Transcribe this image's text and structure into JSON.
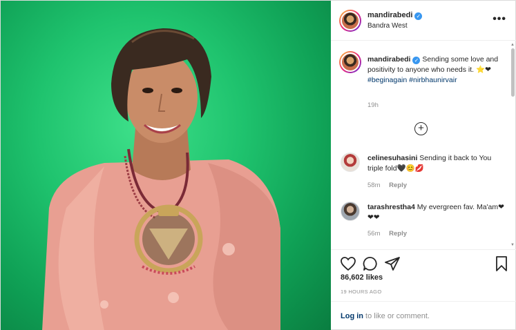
{
  "post": {
    "username": "mandirabedi",
    "location": "Bandra West",
    "more_label": "•••",
    "verified_glyph": "✓"
  },
  "caption": {
    "username": "mandirabedi",
    "text": "Sending some love and positivity to anyone who needs it. ⭐❤",
    "hashtags": "#beginagain #nirbhaunirvair",
    "time": "19h",
    "load_more_glyph": "+"
  },
  "comments": [
    {
      "username": "celinesuhasini",
      "text": "Sending it back to You triple fold🖤😊💋",
      "time": "58m",
      "reply": "Reply"
    },
    {
      "username": "tarashrestha4",
      "text": "My evergreen fav. Ma'am❤❤❤",
      "time": "56m",
      "reply": "Reply"
    }
  ],
  "actions": {
    "likes": "86,602 likes",
    "time_ago": "19 HOURS AGO"
  },
  "login": {
    "link": "Log in",
    "rest": " to like or comment."
  },
  "colors": {
    "accent_blue": "#3897f0",
    "link_dark": "#00376b",
    "heart_red": "#ed4956",
    "photo_green": "#1fc36e"
  },
  "icons": {
    "more": "more-options-icon",
    "load_more": "plus-circle-icon",
    "like": "heart-outline-icon",
    "comment": "comment-bubble-icon",
    "share": "paper-plane-icon",
    "save": "bookmark-icon"
  }
}
